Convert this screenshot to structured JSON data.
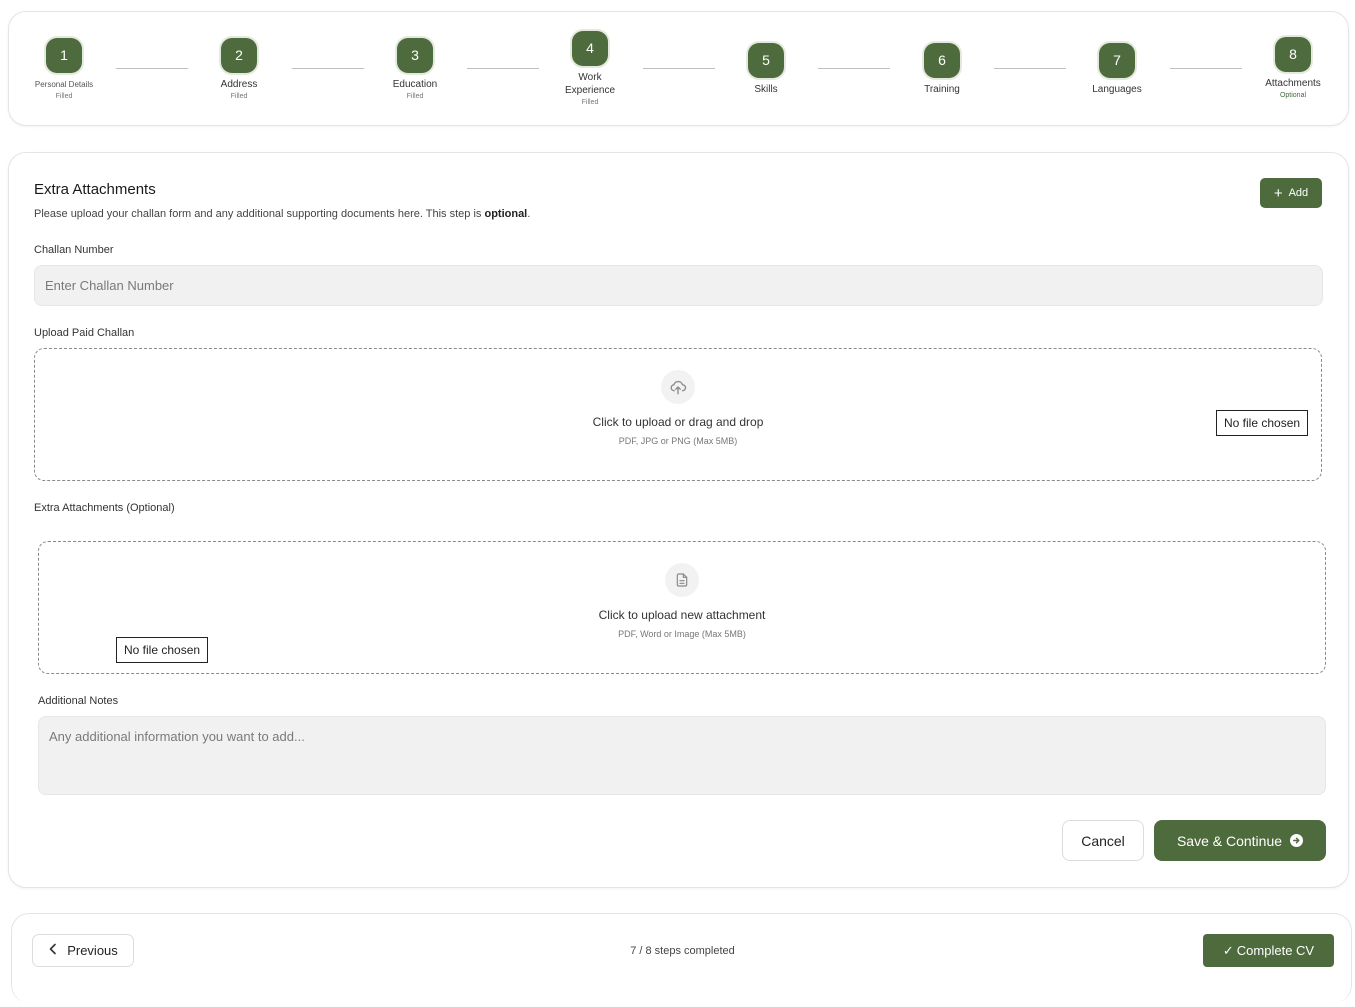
{
  "steps": [
    {
      "num": "1",
      "label": "Personal Details",
      "status": "Filled"
    },
    {
      "num": "2",
      "label": "Address",
      "status": "Filled"
    },
    {
      "num": "3",
      "label": "Education",
      "status": "Filled"
    },
    {
      "num": "4",
      "label": "Work Experience",
      "status": "Filled"
    },
    {
      "num": "5",
      "label": "Skills",
      "status": ""
    },
    {
      "num": "6",
      "label": "Training",
      "status": ""
    },
    {
      "num": "7",
      "label": "Languages",
      "status": ""
    },
    {
      "num": "8",
      "label": "Attachments",
      "status": "Optional"
    }
  ],
  "section": {
    "title": "Extra Attachments",
    "subtitle_prefix": "Please upload your challan form and any additional supporting documents here. This step is ",
    "subtitle_bold": "optional",
    "subtitle_suffix": ".",
    "add_label": "Add",
    "add_icon": "plus-icon"
  },
  "challan_number": {
    "label": "Challan Number",
    "placeholder": "Enter Challan Number",
    "value": ""
  },
  "paid_challan": {
    "label": "Upload Paid Challan",
    "title": "Click to upload or drag and drop",
    "hint": "PDF, JPG or PNG (Max 5MB)",
    "file_status": "No file chosen",
    "icon": "cloud-upload-icon"
  },
  "extra_attachments": {
    "label": "Extra Attachments (Optional)",
    "title": "Click to upload new attachment",
    "hint": "PDF, Word or Image (Max 5MB)",
    "file_status": "No file chosen",
    "icon": "document-icon"
  },
  "additional_notes": {
    "label": "Additional Notes",
    "placeholder": "Any additional information you want to add...",
    "value": ""
  },
  "actions": {
    "cancel_label": "Cancel",
    "save_label": "Save & Continue"
  },
  "footer": {
    "previous_label": "Previous",
    "progress": "7 / 8 steps completed",
    "complete_label": "Complete CV"
  },
  "colors": {
    "accent": "#4e6b3e",
    "input_bg": "#f1f1f1",
    "border": "#e4e4e4"
  }
}
